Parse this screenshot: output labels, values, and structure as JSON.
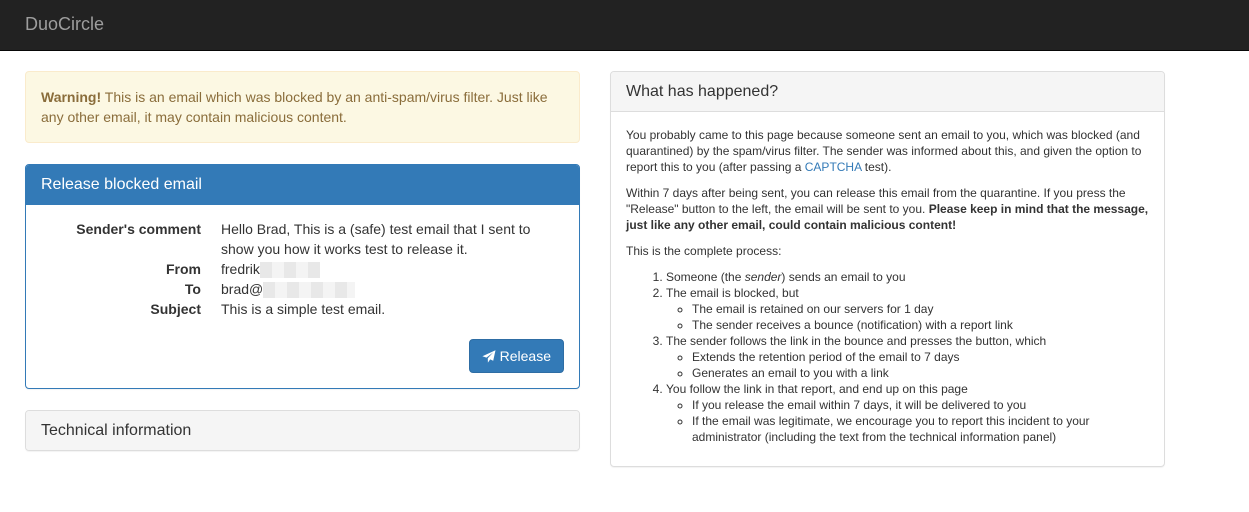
{
  "navbar": {
    "brand": "DuoCircle"
  },
  "warning": {
    "strong": "Warning!",
    "text": " This is an email which was blocked by an anti-spam/virus filter. Just like any other email, it may contain malicious content."
  },
  "release_panel": {
    "title": "Release blocked email",
    "fields": {
      "comment_label": "Sender's comment",
      "comment_value": "Hello Brad, This is a (safe) test email that I sent to show you how it works test to release it.",
      "from_label": "From",
      "from_value": "fredrik",
      "to_label": "To",
      "to_value": "brad@",
      "subject_label": "Subject",
      "subject_value": "This is a simple test email."
    },
    "release_button": "Release"
  },
  "tech_panel": {
    "title": "Technical information"
  },
  "info_panel": {
    "title": "What has happened?",
    "p1_a": "You probably came to this page because someone sent an email to you, which was blocked (and quarantined) by the spam/virus filter. The sender was informed about this, and given the option to report this to you (after passing a ",
    "p1_link": "CAPTCHA",
    "p1_b": " test).",
    "p2_a": "Within 7 days after being sent, you can release this email from the quarantine. If you press the \"Release\" button to the left, the email will be sent to you. ",
    "p2_strong": "Please keep in mind that the message, just like any other email, could contain malicious content!",
    "p3": "This is the complete process:",
    "steps": {
      "s1_a": "Someone (the ",
      "s1_em": "sender",
      "s1_b": ") sends an email to you",
      "s2": "The email is blocked, but",
      "s2_sub1": "The email is retained on our servers for 1 day",
      "s2_sub2": "The sender receives a bounce (notification) with a report link",
      "s3": "The sender follows the link in the bounce and presses the button, which",
      "s3_sub1": "Extends the retention period of the email to 7 days",
      "s3_sub2": "Generates an email to you with a link",
      "s4": "You follow the link in that report, and end up on this page",
      "s4_sub1": "If you release the email within 7 days, it will be delivered to you",
      "s4_sub2": "If the email was legitimate, we encourage you to report this incident to your administrator (including the text from the technical information panel)"
    }
  },
  "colors": {
    "primary": "#337ab7",
    "navbar": "#222222",
    "warning_bg": "#fcf8e3",
    "warning_text": "#8a6d3b"
  },
  "icons": {
    "release": "paper-plane-icon"
  }
}
